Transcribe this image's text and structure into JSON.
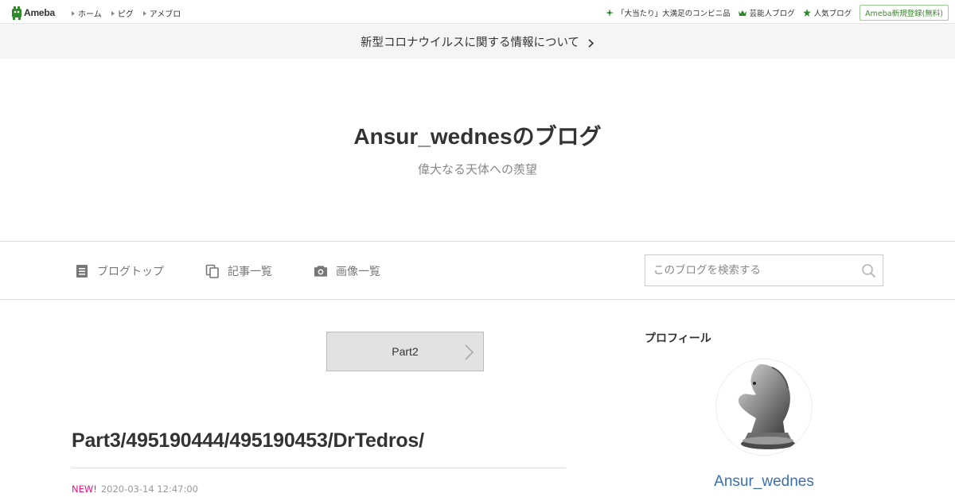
{
  "topbar": {
    "logo_text": "Ameba",
    "nav": [
      "ホーム",
      "ピグ",
      "アメブロ"
    ],
    "right_links": [
      {
        "label": "「大当たり」大満足のコンビニ品",
        "icon": "sparkle-icon"
      },
      {
        "label": "芸能人ブログ",
        "icon": "crown-icon"
      },
      {
        "label": "人気ブログ",
        "icon": "star-icon"
      }
    ],
    "register_label": "Ameba新規登録(無料)"
  },
  "notice": {
    "label": "新型コロナウイルスに関する情報について"
  },
  "blog": {
    "title": "Ansur_wednesのブログ",
    "subtitle": "偉大なる天体への羨望"
  },
  "nav": {
    "items": [
      {
        "label": "ブログトップ",
        "icon": "document-icon"
      },
      {
        "label": "記事一覧",
        "icon": "copy-icon"
      },
      {
        "label": "画像一覧",
        "icon": "camera-icon"
      }
    ],
    "search_placeholder": "このブログを検索する"
  },
  "main": {
    "pager_label": "Part2",
    "entry_title": "Part3/495190444/495190453/DrTedros/",
    "new_badge": "NEW!",
    "entry_date": "2020-03-14 12:47:00"
  },
  "sidebar": {
    "heading": "プロフィール",
    "name": "Ansur_wednes"
  },
  "colors": {
    "brand_green": "#3a8a2c",
    "link_blue": "#3c6fb0",
    "new_pink": "#e4147c"
  }
}
